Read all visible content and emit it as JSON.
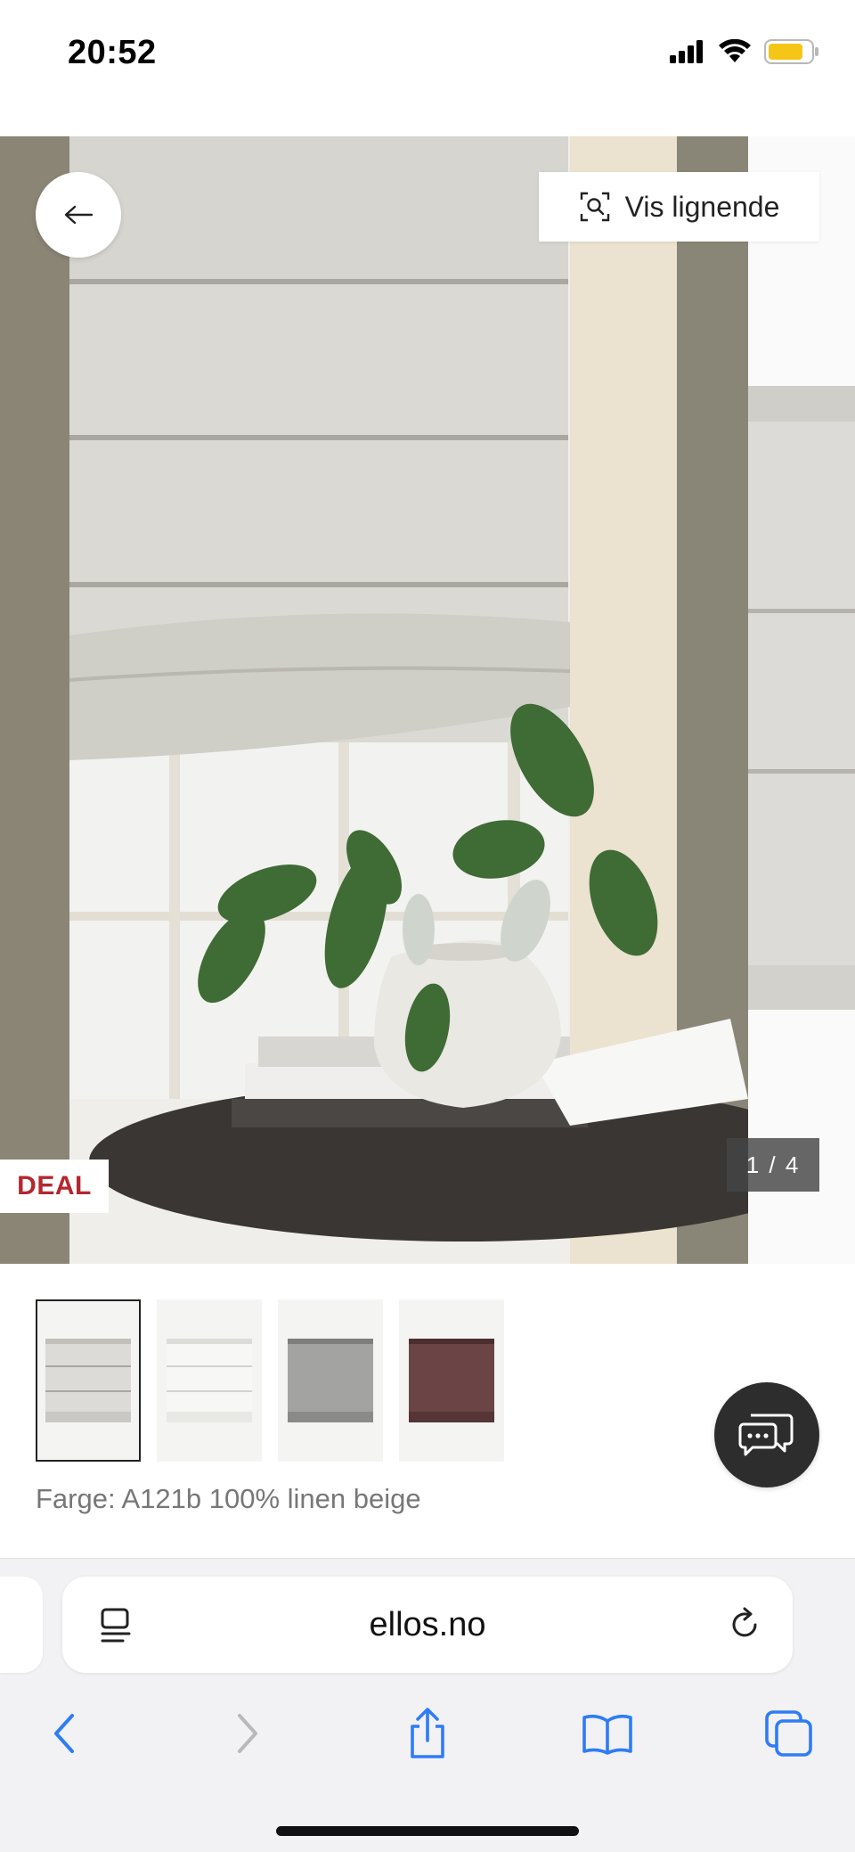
{
  "status_bar": {
    "time": "20:52",
    "icons": [
      "cellular-signal-icon",
      "wifi-icon",
      "battery-icon"
    ],
    "battery_color": "#f5c518"
  },
  "gallery": {
    "similar_button_label": "Vis lignende",
    "deal_badge": "DEAL",
    "counter": "1 / 4",
    "current_image": 1,
    "total_images": 4
  },
  "thumbnails": [
    {
      "color": "#c9c8c4",
      "selected": true
    },
    {
      "color": "#eeeeec",
      "selected": false
    },
    {
      "color": "#9a9a9a",
      "selected": false
    },
    {
      "color": "#6b4545",
      "selected": false
    }
  ],
  "product": {
    "color_label": "Farge: A121b 100% linen beige"
  },
  "browser": {
    "url": "ellos.no",
    "toolbar": [
      "back-icon",
      "forward-icon",
      "share-icon",
      "bookmarks-icon",
      "tabs-icon"
    ],
    "accent_color": "#2f7cf6"
  },
  "colors": {
    "deal_red": "#b3282d",
    "chat_bg": "#2d2d2d"
  }
}
